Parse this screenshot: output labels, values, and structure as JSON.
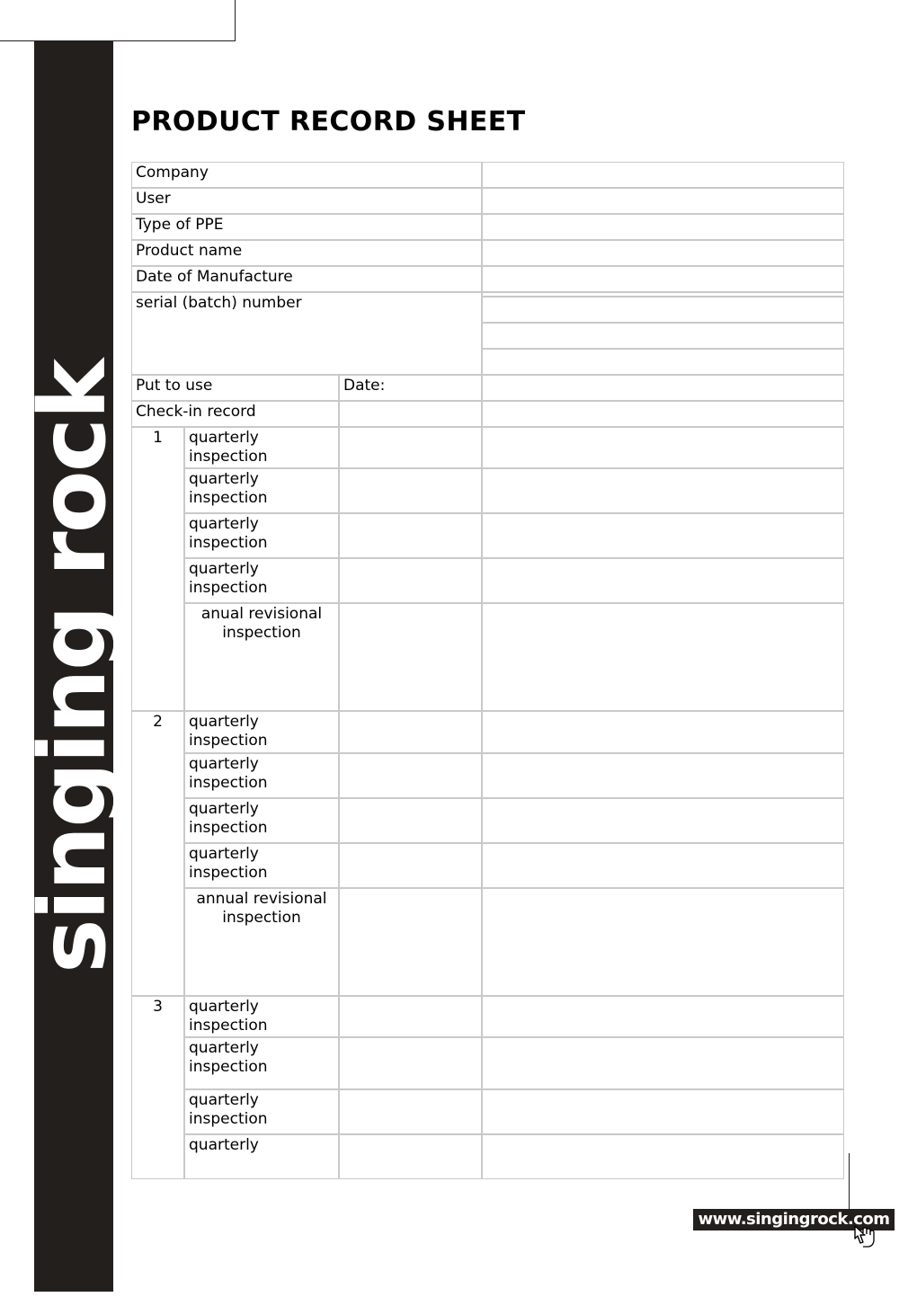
{
  "brand": {
    "sidebar_text": "singing rock",
    "website_banner": "www.singingrock.com",
    "banner_bg": "#231f1c",
    "sidebar_bg": "#231f1c"
  },
  "page": {
    "title": "PRODUCT RECORD SHEET",
    "border_color": "#c9c9c9"
  },
  "cursor": {
    "icon": "pointing-hand-cursor"
  },
  "form": {
    "fields": [
      {
        "label": "Company",
        "value": ""
      },
      {
        "label": "User",
        "value": ""
      },
      {
        "label": "Type of PPE",
        "value": ""
      },
      {
        "label": "Product name",
        "value": ""
      },
      {
        "label": "Date of Manufacture",
        "value": ""
      }
    ],
    "serial": {
      "label": "serial (batch) number",
      "entries": [
        "",
        "",
        "",
        ""
      ]
    },
    "put_to_use": {
      "label": "Put to use",
      "date_label": "Date:",
      "value": ""
    },
    "check_in_record": {
      "label": "Check-in record",
      "date_value": "",
      "note_value": ""
    },
    "groups": [
      {
        "number": "1",
        "rows": [
          {
            "label_line1": "quarterly",
            "label_line2": "inspection",
            "date": "",
            "note": ""
          },
          {
            "label_line1": "quarterly",
            "label_line2": "inspection",
            "date": "",
            "note": ""
          },
          {
            "label_line1": "quarterly",
            "label_line2": "inspection",
            "date": "",
            "note": ""
          },
          {
            "label_line1": "quarterly",
            "label_line2": "inspection",
            "date": "",
            "note": ""
          }
        ],
        "annual": {
          "label_line1": "anual revisional",
          "label_line2": "inspection",
          "date": "",
          "note": ""
        }
      },
      {
        "number": "2",
        "rows": [
          {
            "label_line1": "quarterly",
            "label_line2": "inspection",
            "date": "",
            "note": ""
          },
          {
            "label_line1": "quarterly",
            "label_line2": "inspection",
            "date": "",
            "note": ""
          },
          {
            "label_line1": "quarterly",
            "label_line2": "inspection",
            "date": "",
            "note": ""
          },
          {
            "label_line1": "quarterly",
            "label_line2": "inspection",
            "date": "",
            "note": ""
          }
        ],
        "annual": {
          "label_line1": "annual revisional",
          "label_line2": "inspection",
          "date": "",
          "note": ""
        }
      },
      {
        "number": "3",
        "rows": [
          {
            "label_line1": "quarterly",
            "label_line2": "inspection",
            "date": "",
            "note": ""
          },
          {
            "label_line1": "quarterly",
            "label_line2": "inspection",
            "date": "",
            "note": ""
          },
          {
            "label_line1": "quarterly",
            "label_line2": "inspection",
            "date": "",
            "note": ""
          },
          {
            "label_line1": "quarterly",
            "label_line2": "",
            "date": "",
            "note": ""
          }
        ]
      }
    ]
  }
}
